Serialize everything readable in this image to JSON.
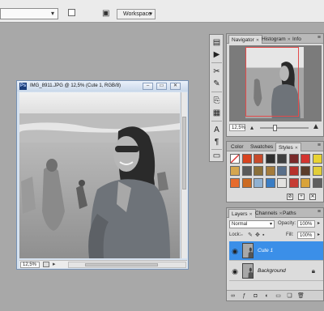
{
  "workspace": {
    "label": "Workspace"
  },
  "document": {
    "title": "IMG_8911.JPG @ 12,5% (Cute 1, RGB/8)",
    "zoom": "12,5%",
    "controls": {
      "minimize": "–",
      "restore": "▭",
      "close": "✕"
    }
  },
  "panels": {
    "navigator": {
      "tabs": [
        "Navigator",
        "Histogram",
        "Info"
      ],
      "active_tab": "Navigator",
      "zoom": "12,5%",
      "zoom_level": 0.3
    },
    "styles": {
      "tabs": [
        "Color",
        "Swatches",
        "Styles"
      ],
      "active_tab": "Styles",
      "swatch_colors": [
        "#f4f4f4",
        "#d8431f",
        "#c74a2b",
        "#2f2f2f",
        "#3f3f3f",
        "#7a2a2a",
        "#d4342f",
        "#e8d233",
        "#d5a64f",
        "#5a5a5a",
        "#8a6f3a",
        "#a47b3a",
        "#596f8a",
        "#b6322c",
        "#5b3d2a",
        "#e2ce3a",
        "#e66b2c",
        "#cc6b22",
        "#8fb1d2",
        "#3a7dc4",
        "#e3e2e0",
        "#c63c34",
        "#d9a33a",
        "#5f5f5f"
      ]
    },
    "layers": {
      "tabs": [
        "Layers",
        "Channels",
        "Paths"
      ],
      "active_tab": "Layers",
      "blend_mode": "Normal",
      "opacity_label": "Opacity:",
      "opacity": "100%",
      "lock_label": "Lock:",
      "fill_label": "Fill:",
      "fill": "100%",
      "items": [
        {
          "name": "Cute 1",
          "selected": true
        },
        {
          "name": "Background",
          "selected": false,
          "locked": true
        }
      ]
    }
  }
}
